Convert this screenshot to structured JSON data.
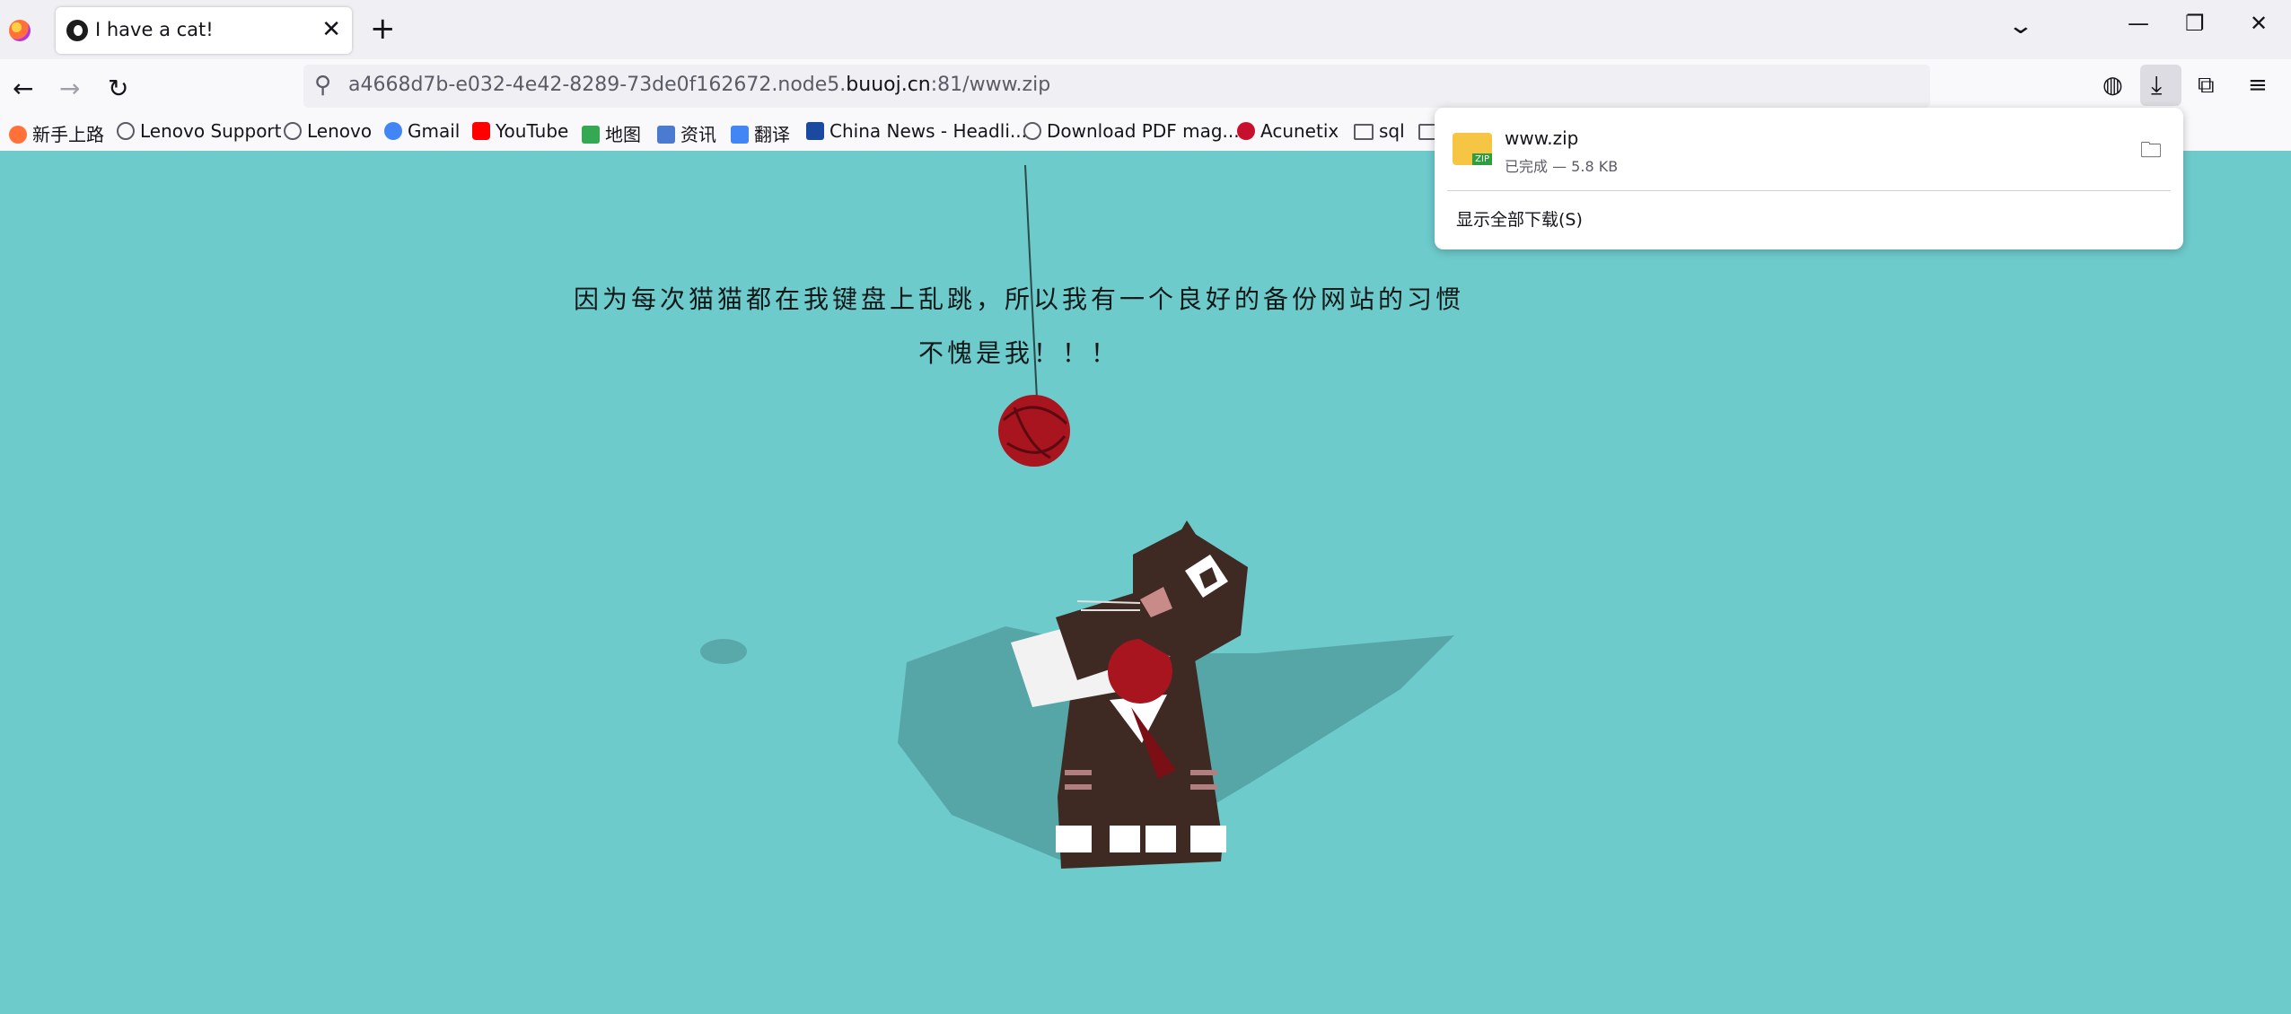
{
  "tabs": [
    {
      "title": "I have a cat!",
      "close": "✕"
    }
  ],
  "tabbar": {
    "new_tab": "+",
    "list_tabs": "⌄",
    "minimize": "—",
    "restore": "❐",
    "close": "✕"
  },
  "nav": {
    "back": "←",
    "forward": "→",
    "reload": "↻"
  },
  "urlbar": {
    "search_icon": "⚲",
    "url_prefix": "a4668d7b-e032-4e42-8289-73de0f162672.node5.",
    "url_host": "buuoj.cn",
    "url_suffix": ":81/www.zip"
  },
  "toolbar": {
    "pocket": "◍",
    "download": "⤓",
    "extensions": "⧉",
    "menu": "≡"
  },
  "bookmarks": [
    {
      "label": "新手上路",
      "icon": "firefox-icon",
      "color": "#ff7139"
    },
    {
      "label": "Lenovo Support",
      "icon": "globe-icon",
      "color": "#5b5b66"
    },
    {
      "label": "Lenovo",
      "icon": "globe-icon",
      "color": "#5b5b66"
    },
    {
      "label": "Gmail",
      "icon": "google-icon",
      "color": "#4285f4"
    },
    {
      "label": "YouTube",
      "icon": "youtube-icon",
      "color": "#ff0000"
    },
    {
      "label": "地图",
      "icon": "maps-icon",
      "color": "#34a853"
    },
    {
      "label": "资讯",
      "icon": "news-icon",
      "color": "#4a7bd0"
    },
    {
      "label": "翻译",
      "icon": "translate-icon",
      "color": "#4285f4"
    },
    {
      "label": "China News - Headli...",
      "icon": "chinanews-icon",
      "color": "#1a4aa0"
    },
    {
      "label": "Download PDF mag...",
      "icon": "globe-icon",
      "color": "#5b5b66"
    },
    {
      "label": "Acunetix",
      "icon": "acunetix-icon",
      "color": "#c8102e"
    },
    {
      "label": "sql",
      "icon": "folder-icon",
      "color": "#5b5b66"
    }
  ],
  "page": {
    "line1": "因为每次猫猫都在我键盘上乱跳，所以我有一个良好的备份网站的习惯",
    "line2": "不愧是我！！！"
  },
  "download_panel": {
    "file_name": "www.zip",
    "status": "已完成 — 5.8 KB",
    "show_all": "显示全部下载(S)",
    "folder_icon": "🗀"
  },
  "colors": {
    "page_bg": "#6ecbcc",
    "yarn": "#a8151e",
    "cat": "#3e2a23"
  }
}
